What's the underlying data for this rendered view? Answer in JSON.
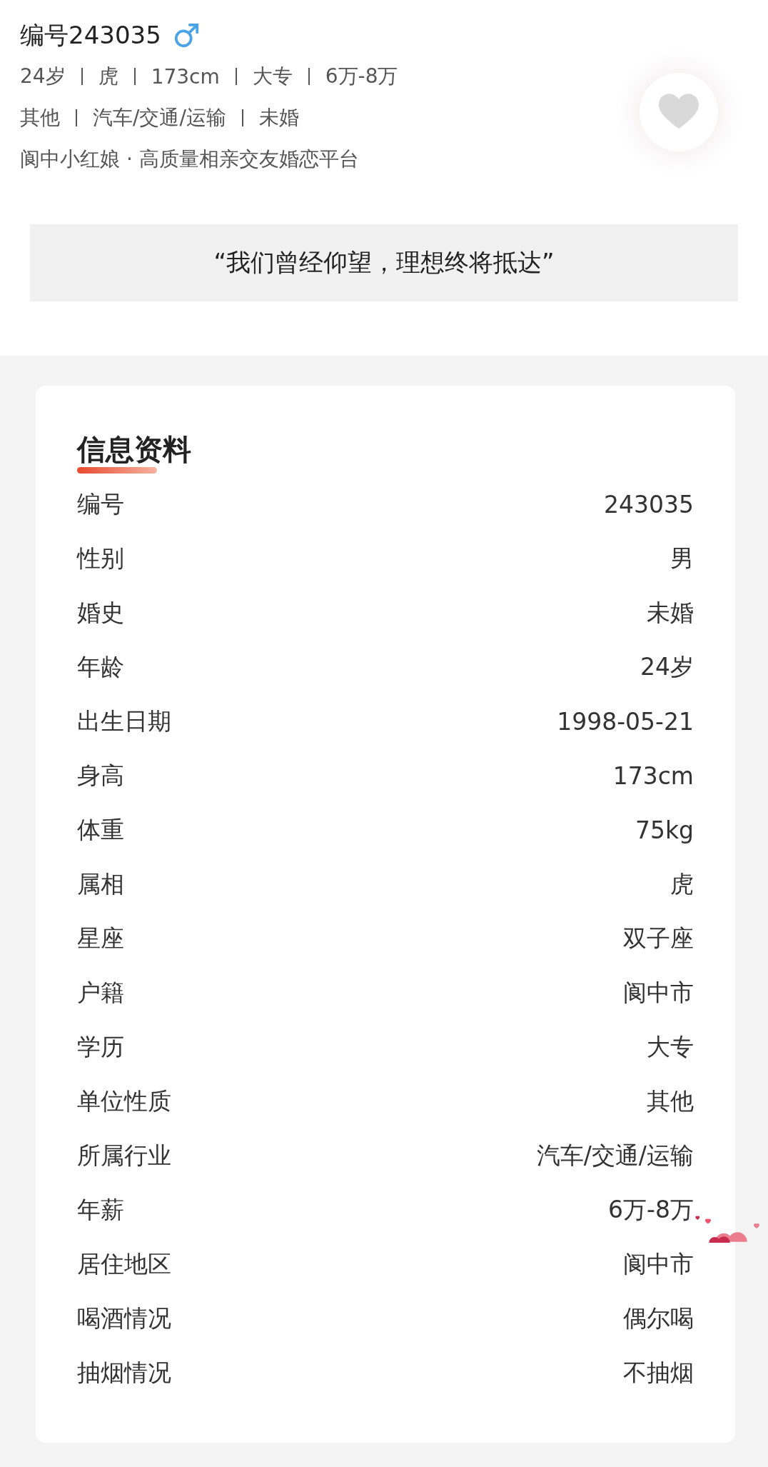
{
  "profile": {
    "title": "编号243035",
    "tags": [
      "24岁",
      "虎",
      "173cm",
      "大专",
      "6万-8万"
    ],
    "tags_2": [
      "其他",
      "汽车/交通/运输",
      "未婚"
    ],
    "platform": "阆中小红娘 · 高质量相亲交友婚恋平台",
    "liked": false
  },
  "quote": "“我们曾经仰望，理想终将抵达”",
  "info": {
    "heading": "信息资料",
    "rows": [
      {
        "label": "编号",
        "value": "243035"
      },
      {
        "label": "性别",
        "value": "男"
      },
      {
        "label": "婚史",
        "value": "未婚"
      },
      {
        "label": "年龄",
        "value": "24岁"
      },
      {
        "label": "出生日期",
        "value": "1998-05-21"
      },
      {
        "label": "身高",
        "value": "173cm"
      },
      {
        "label": "体重",
        "value": "75kg"
      },
      {
        "label": "属相",
        "value": "虎"
      },
      {
        "label": "星座",
        "value": "双子座"
      },
      {
        "label": "户籍",
        "value": "阆中市"
      },
      {
        "label": "学历",
        "value": "大专"
      },
      {
        "label": "单位性质",
        "value": "其他"
      },
      {
        "label": "所属行业",
        "value": "汽车/交通/运输"
      },
      {
        "label": "年薪",
        "value": "6万-8万"
      },
      {
        "label": "居住地区",
        "value": "阆中市"
      },
      {
        "label": "喝酒情况",
        "value": "偶尔喝"
      },
      {
        "label": "抽烟情况",
        "value": "不抽烟"
      }
    ]
  }
}
